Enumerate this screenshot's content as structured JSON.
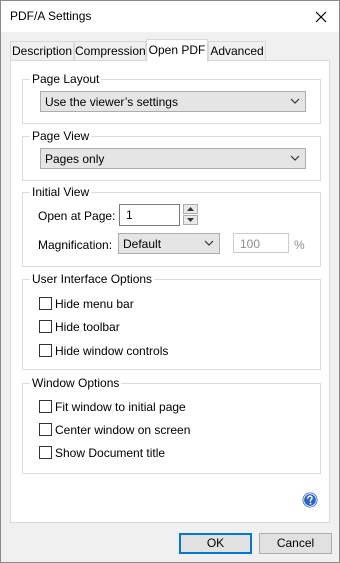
{
  "window": {
    "title": "PDF/A Settings"
  },
  "tabs": [
    {
      "label": "Description"
    },
    {
      "label": "Compression"
    },
    {
      "label": "Open PDF"
    },
    {
      "label": "Advanced"
    }
  ],
  "active_tab": "Open PDF",
  "page_layout": {
    "label": "Page Layout",
    "value": "Use the viewer’s settings"
  },
  "page_view": {
    "label": "Page View",
    "value": "Pages only"
  },
  "initial_view": {
    "label": "Initial View",
    "open_at_page_label": "Open at Page:",
    "open_at_page_value": "1",
    "magnification_label": "Magnification:",
    "magnification_value": "Default",
    "percent_value": "100",
    "percent_unit": "%"
  },
  "ui_options": {
    "label": "User Interface Options",
    "items": [
      {
        "label": "Hide menu bar",
        "checked": false
      },
      {
        "label": "Hide toolbar",
        "checked": false
      },
      {
        "label": "Hide window controls",
        "checked": false
      }
    ]
  },
  "window_options": {
    "label": "Window Options",
    "items": [
      {
        "label": "Fit window to initial page",
        "checked": false
      },
      {
        "label": "Center window on screen",
        "checked": false
      },
      {
        "label": "Show Document title",
        "checked": false
      }
    ]
  },
  "buttons": {
    "ok": "OK",
    "cancel": "Cancel"
  },
  "icons": {
    "close": "close-icon",
    "help": "help-icon",
    "dropdown": "chevron-down-icon"
  },
  "colors": {
    "accent": "#0078d7",
    "help_blue": "#2a64c5"
  }
}
